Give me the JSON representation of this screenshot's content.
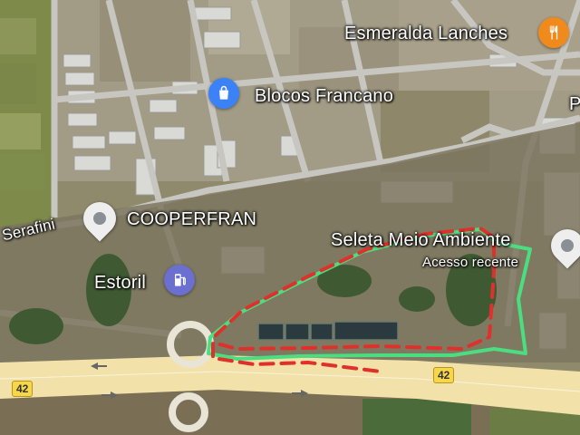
{
  "places": {
    "esmeralda": {
      "name": "Esmeralda Lanches",
      "icon": "fork-knife-icon",
      "color": "#f08a1c"
    },
    "blocos": {
      "name": "Blocos Francano",
      "icon": "shopping-bag-icon",
      "color": "#3b82f6"
    },
    "cooperfran": {
      "name": "COOPERFRAN",
      "icon": "location-pin-icon",
      "color": "#8a8f96"
    },
    "estoril": {
      "name": "Estoril",
      "icon": "gas-station-icon",
      "color": "#6b6fcf"
    },
    "seleta": {
      "name": "Seleta Meio Ambiente",
      "note": "Acesso recente",
      "icon": "location-pin-icon",
      "color": "#8a8f96"
    }
  },
  "streets": {
    "serafini": "Serafini"
  },
  "edge_labels": {
    "right_top": "P"
  },
  "highway": {
    "route_number": "42",
    "color": "#f7d64a"
  },
  "overlay": {
    "green_outline_color": "#4ade80",
    "red_dashed_color": "#e0302b"
  }
}
